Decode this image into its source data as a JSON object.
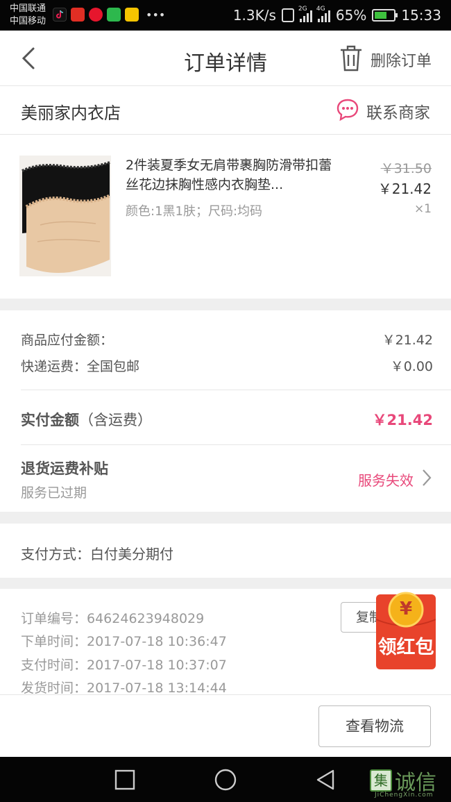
{
  "status_bar": {
    "carrier_1": "中国联通",
    "carrier_2": "中国移动",
    "speed": "1.3K/s",
    "battery": "65%",
    "time": "15:33",
    "app_icons": [
      "tiktok-icon",
      "red-app-icon",
      "weibo-icon",
      "video-app-icon",
      "yellow-app-icon"
    ]
  },
  "header": {
    "title": "订单详情",
    "delete_label": "删除订单"
  },
  "shop": {
    "name": "美丽家内衣店",
    "contact_label": "联系商家"
  },
  "product": {
    "name": "2件装夏季女无肩带裹胸防滑带扣蕾丝花边抹胸性感内衣胸垫...",
    "spec": "颜色:1黑1肤；尺码:均码",
    "original_price": "￥31.50",
    "price": "￥21.42",
    "quantity": "×1"
  },
  "amount": {
    "goods_label": "商品应付金额：",
    "goods_value": "￥21.42",
    "shipping_label": "快递运费：全国包邮",
    "shipping_value": "￥0.00",
    "paid_label": "实付金额",
    "paid_note": "（含运费）",
    "paid_value": "￥21.42",
    "refund_title": "退货运费补贴",
    "refund_desc": "服务已过期",
    "service_status": "服务失效"
  },
  "payment": {
    "method": "支付方式：白付美分期付"
  },
  "order_info": {
    "order_no": "订单编号：64624623948029",
    "order_time": "下单时间：2017-07-18  10:36:47",
    "pay_time": "支付时间：2017-07-18  10:37:07",
    "ship_time": "发货时间：2017-07-18  13:14:44",
    "copy_label": "复制"
  },
  "red_packet": {
    "label": "领红包",
    "coin_symbol": "¥"
  },
  "bottom": {
    "logistics_label": "查看物流"
  },
  "watermark": {
    "box_char": "集",
    "text": "诚信",
    "sub": "JiChengXin.com"
  },
  "colors": {
    "accent": "#e8487a",
    "red_packet": "#e8432b",
    "coin": "#f5b21a"
  }
}
